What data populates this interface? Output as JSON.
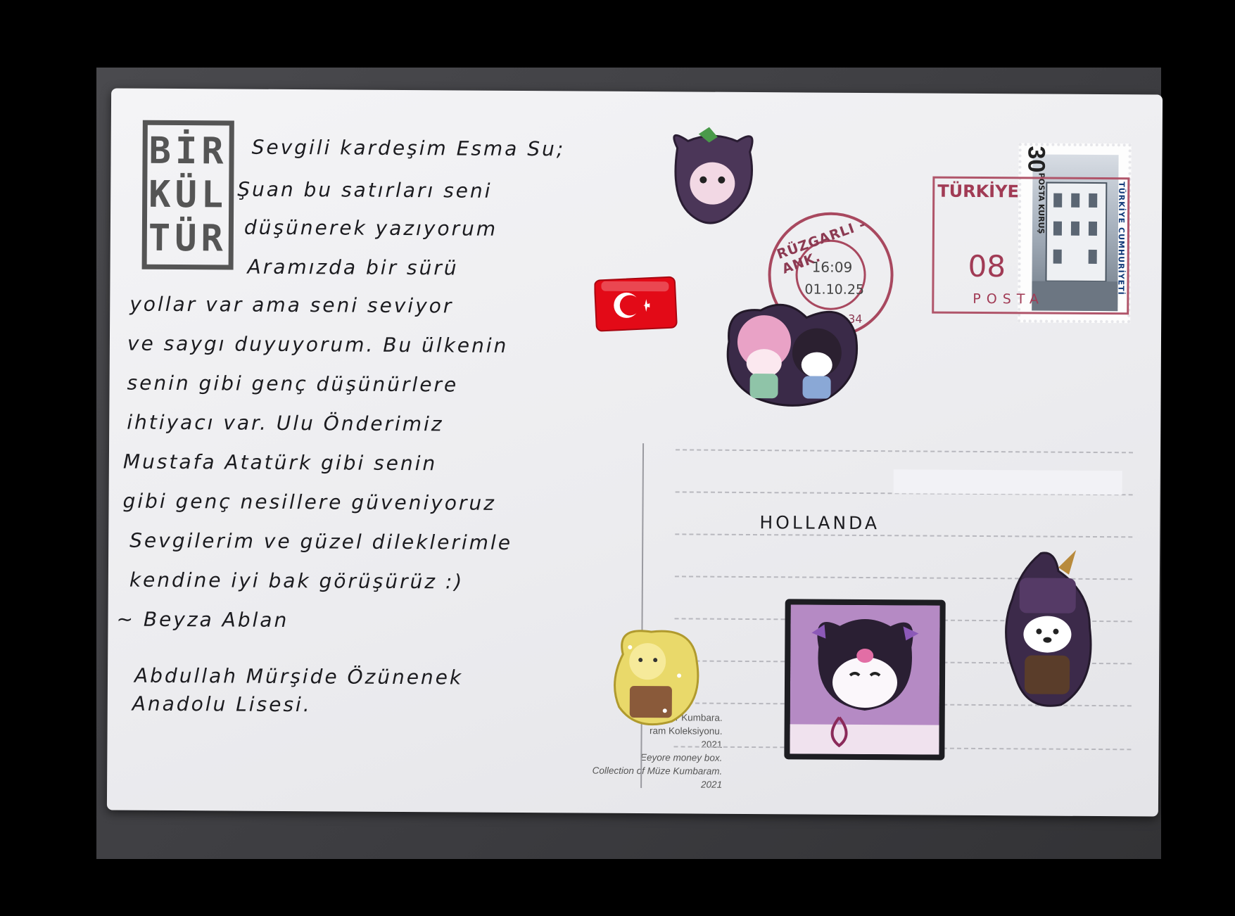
{
  "logo": {
    "lines": [
      "BİR",
      "KÜL",
      "TÜR"
    ]
  },
  "letter_lines": [
    "Sevgili kardeşim Esma Su;",
    "Şuan bu satırları seni",
    "düşünerek yazıyorum",
    "Aramızda bir sürü",
    "yollar var ama seni seviyor",
    "ve saygı duyuyorum. Bu ülkenin",
    "senin gibi genç düşünürlere",
    "ihtiyacı var. Ulu Önderimiz",
    "Mustafa Atatürk gibi senin",
    "gibi genç nesillere güveniyoruz",
    "Sevgilerim ve güzel dileklerimle",
    "kendine iyi bak görüşürüz :)",
    "~ Beyza Ablan"
  ],
  "sender_lines": [
    "Abdullah Mürşide Özünenek",
    "Anadolu Lisesi."
  ],
  "caption": {
    "line1": "lyor Kumbara.",
    "line2": "ram Koleksiyonu.",
    "line3": "2021",
    "line4": "Eeyore money box.",
    "line5": "Collection of Müze Kumbaram.",
    "line6": "2021"
  },
  "address": {
    "country": "HOLLANDA"
  },
  "stamp": {
    "value": "30",
    "unit": "KURUŞ",
    "label": "POSTA",
    "country": "TÜRKİYE CUMHURİYETİ"
  },
  "postmark": {
    "city": "RÜZGARLI - ANK.",
    "time": "16:09",
    "date": "01.10.25",
    "code": "34"
  },
  "meter": {
    "country": "TÜRKİYE",
    "value": "08",
    "label": "POSTA"
  },
  "colors": {
    "postmark_ink": "#a8485f",
    "flag_red": "#e30a17"
  },
  "stickers": [
    "kuromi-sticker",
    "turkish-flag-sticker",
    "my-melody-kuromi-sticker",
    "pompompurin-sticker",
    "kuromi-portrait-sticker",
    "pochacco-sticker"
  ]
}
